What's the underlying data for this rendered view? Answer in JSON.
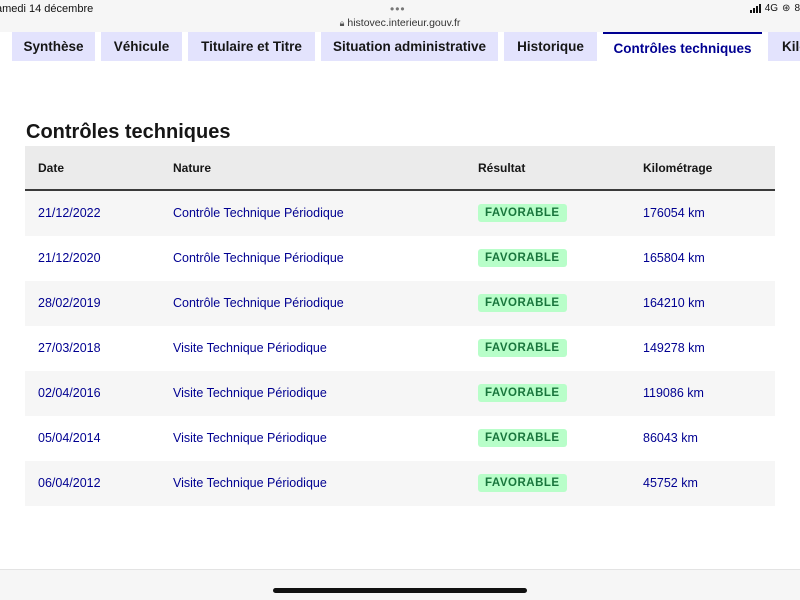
{
  "status_bar": {
    "date": "amedi 14 décembre",
    "url": "histovec.interieur.gouv.fr",
    "network": "4G",
    "battery_partial": "8"
  },
  "tabs": [
    {
      "label": "Synthèse",
      "active": false
    },
    {
      "label": "Véhicule",
      "active": false
    },
    {
      "label": "Titulaire et Titre",
      "active": false
    },
    {
      "label": "Situation administrative",
      "active": false
    },
    {
      "label": "Historique",
      "active": false
    },
    {
      "label": "Contrôles techniques",
      "active": true
    },
    {
      "label": "Kilo",
      "active": false
    }
  ],
  "section_title": "Contrôles techniques",
  "table": {
    "headers": [
      "Date",
      "Nature",
      "Résultat",
      "Kilométrage"
    ],
    "rows": [
      {
        "date": "21/12/2022",
        "nature": "Contrôle Technique Périodique",
        "result": "FAVORABLE",
        "km": "176054 km"
      },
      {
        "date": "21/12/2020",
        "nature": "Contrôle Technique Périodique",
        "result": "FAVORABLE",
        "km": "165804 km"
      },
      {
        "date": "28/02/2019",
        "nature": "Contrôle Technique Périodique",
        "result": "FAVORABLE",
        "km": "164210 km"
      },
      {
        "date": "27/03/2018",
        "nature": "Visite Technique Périodique",
        "result": "FAVORABLE",
        "km": "149278 km"
      },
      {
        "date": "02/04/2016",
        "nature": "Visite Technique Périodique",
        "result": "FAVORABLE",
        "km": "119086 km"
      },
      {
        "date": "05/04/2014",
        "nature": "Visite Technique Périodique",
        "result": "FAVORABLE",
        "km": "86043 km"
      },
      {
        "date": "06/04/2012",
        "nature": "Visite Technique Périodique",
        "result": "FAVORABLE",
        "km": "45752 km"
      }
    ]
  },
  "colors": {
    "accent": "#000091",
    "tab_inactive_bg": "#e3e3fd",
    "badge_bg": "#b8fec9",
    "badge_text": "#18753c"
  }
}
